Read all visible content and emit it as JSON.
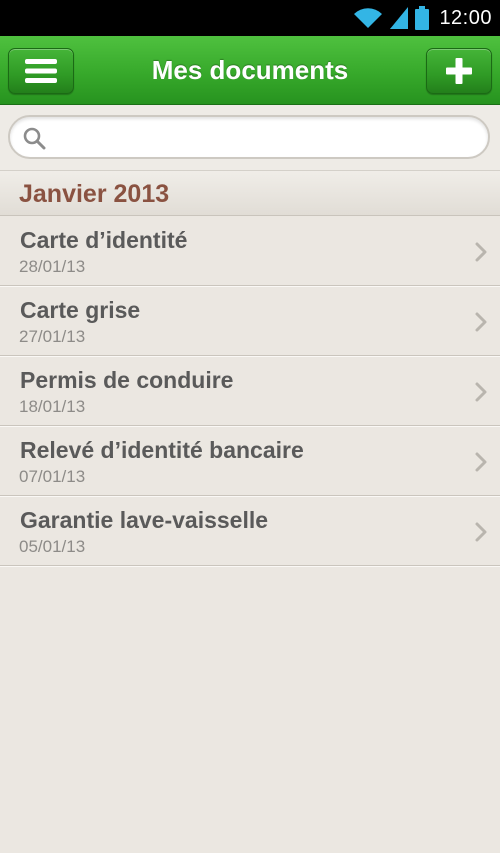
{
  "status_bar": {
    "time": "12:00",
    "icons": [
      "wifi-icon",
      "signal-icon",
      "battery-icon"
    ]
  },
  "header": {
    "title": "Mes documents",
    "menu_icon": "hamburger-menu-icon",
    "add_icon": "plus-icon"
  },
  "search": {
    "placeholder": "",
    "value": "",
    "icon": "search-icon"
  },
  "section": {
    "title": "Janvier 2013"
  },
  "documents": [
    {
      "title": "Carte d’identité",
      "date": "28/01/13"
    },
    {
      "title": "Carte grise",
      "date": "27/01/13"
    },
    {
      "title": "Permis de conduire",
      "date": "18/01/13"
    },
    {
      "title": "Relevé d’identité bancaire",
      "date": "07/01/13"
    },
    {
      "title": "Garantie lave-vaisselle",
      "date": "05/01/13"
    }
  ],
  "colors": {
    "header_green": "#37a92b",
    "section_title": "#8a5241",
    "background": "#ebe7e1",
    "status_icons": "#33b5e5"
  }
}
